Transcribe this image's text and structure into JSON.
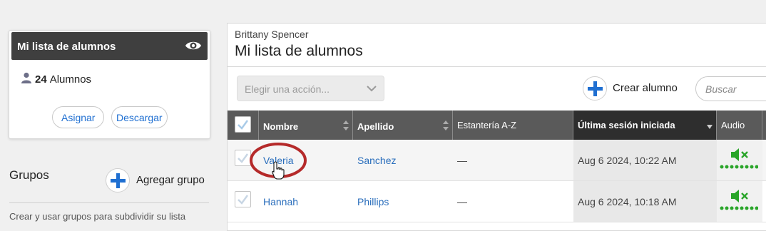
{
  "sidebar": {
    "roster_card": {
      "title": "Mi lista de alumnos",
      "student_count": "24",
      "student_label": "Alumnos",
      "assign_label": "Asignar",
      "download_label": "Descargar"
    },
    "groups": {
      "title": "Grupos",
      "add_label": "Agregar grupo",
      "description": "Crear y usar grupos para subdividir su lista"
    }
  },
  "main": {
    "teacher_name": "Brittany Spencer",
    "title": "Mi lista de alumnos",
    "action_placeholder": "Elegir una acción...",
    "create_label": "Crear alumno",
    "search_placeholder": "Buscar",
    "table": {
      "headers": {
        "first_name": "Nombre",
        "last_name": "Apellido",
        "shelf": "Estantería A-Z",
        "last_login": "Última sesión iniciada",
        "audio": "Audio"
      },
      "rows": [
        {
          "first_name": "Valeria",
          "last_name": "Sanchez",
          "shelf": "—",
          "last_login": "Aug 6 2024, 10:22 AM",
          "audio": "muted"
        },
        {
          "first_name": "Hannah",
          "last_name": "Phillips",
          "shelf": "—",
          "last_login": "Aug 6 2024, 10:18 AM",
          "audio": "muted"
        }
      ]
    }
  },
  "colors": {
    "accent_blue": "#1f6fd1",
    "link_blue": "#2a6ebc",
    "audio_green": "#2aa52a",
    "annotation_red": "#b52a2a",
    "header_dark": "#3f3f3f"
  }
}
